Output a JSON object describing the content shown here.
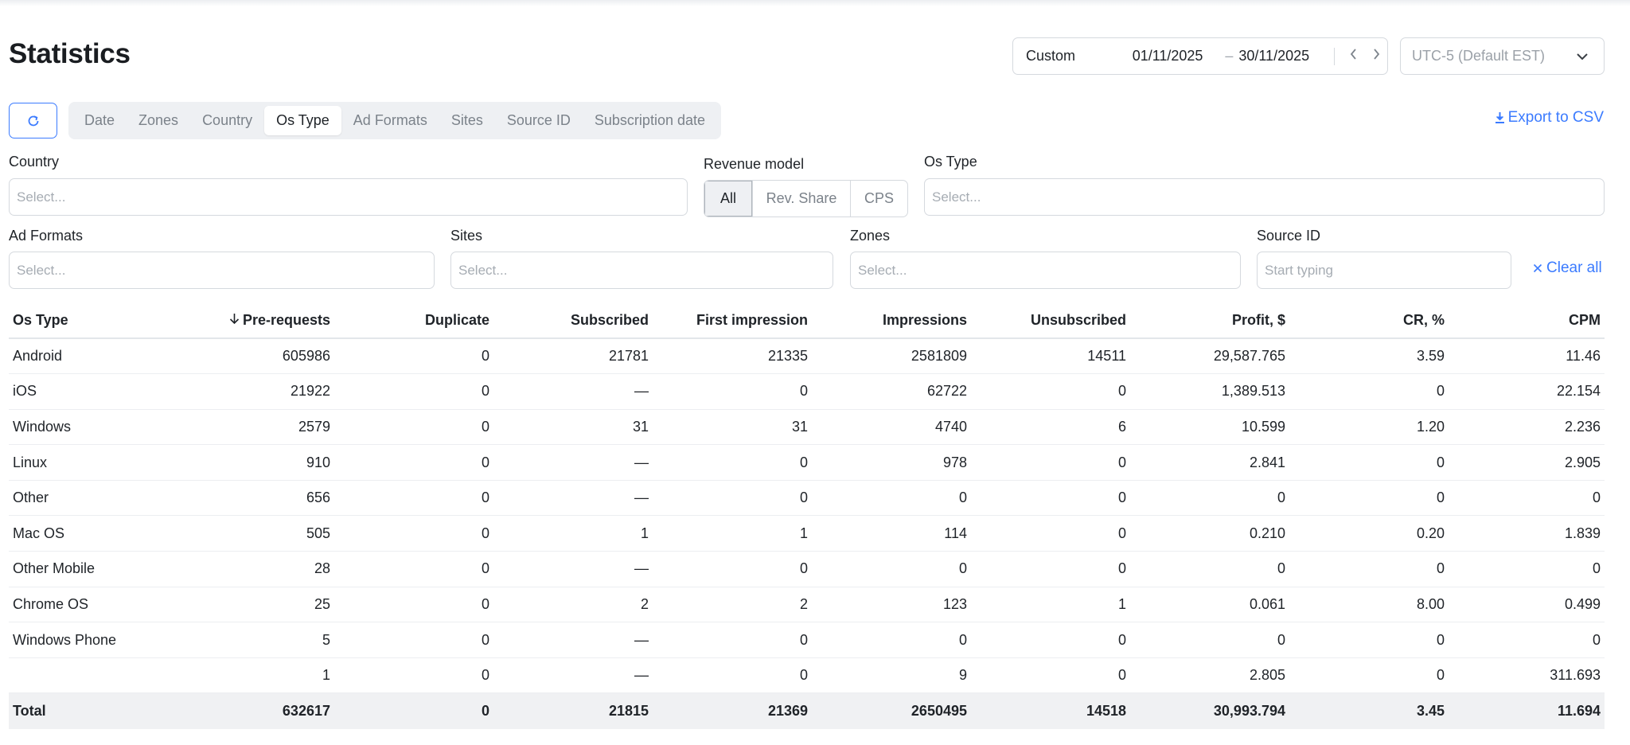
{
  "page": {
    "title": "Statistics"
  },
  "date_range": {
    "preset": "Custom",
    "from": "01/11/2025",
    "separator": "–",
    "to": "30/11/2025",
    "prev_icon": "chevron-left-icon",
    "next_icon": "chevron-right-icon"
  },
  "timezone": {
    "value": "UTC-5 (Default EST)"
  },
  "tabs": [
    {
      "label": "Date",
      "active": false
    },
    {
      "label": "Zones",
      "active": false
    },
    {
      "label": "Country",
      "active": false
    },
    {
      "label": "Os Type",
      "active": true
    },
    {
      "label": "Ad Formats",
      "active": false
    },
    {
      "label": "Sites",
      "active": false
    },
    {
      "label": "Source ID",
      "active": false
    },
    {
      "label": "Subscription date",
      "active": false
    }
  ],
  "export": {
    "label": "Export to CSV",
    "icon": "download-icon"
  },
  "filters": {
    "country": {
      "label": "Country",
      "placeholder": "Select..."
    },
    "revenue_model": {
      "label": "Revenue model",
      "options": [
        "All",
        "Rev. Share",
        "CPS"
      ],
      "selected": "All"
    },
    "os_type": {
      "label": "Os Type",
      "placeholder": "Select..."
    },
    "ad_formats": {
      "label": "Ad Formats",
      "placeholder": "Select..."
    },
    "sites": {
      "label": "Sites",
      "placeholder": "Select..."
    },
    "zones": {
      "label": "Zones",
      "placeholder": "Select..."
    },
    "source_id": {
      "label": "Source ID",
      "placeholder": "Start typing"
    },
    "clear_all": "Clear all"
  },
  "table": {
    "columns": [
      "Os Type",
      "Pre-requests",
      "Duplicate",
      "Subscribed",
      "First impression",
      "Impressions",
      "Unsubscribed",
      "Profit, $",
      "CR, %",
      "CPM"
    ],
    "sorted_column": "Pre-requests",
    "rows": [
      [
        "Android",
        "605986",
        "0",
        "21781",
        "21335",
        "2581809",
        "14511",
        "29,587.765",
        "3.59",
        "11.46"
      ],
      [
        "iOS",
        "21922",
        "0",
        "—",
        "0",
        "62722",
        "0",
        "1,389.513",
        "0",
        "22.154"
      ],
      [
        "Windows",
        "2579",
        "0",
        "31",
        "31",
        "4740",
        "6",
        "10.599",
        "1.20",
        "2.236"
      ],
      [
        "Linux",
        "910",
        "0",
        "—",
        "0",
        "978",
        "0",
        "2.841",
        "0",
        "2.905"
      ],
      [
        "Other",
        "656",
        "0",
        "—",
        "0",
        "0",
        "0",
        "0",
        "0",
        "0"
      ],
      [
        "Mac OS",
        "505",
        "0",
        "1",
        "1",
        "114",
        "0",
        "0.210",
        "0.20",
        "1.839"
      ],
      [
        "Other Mobile",
        "28",
        "0",
        "—",
        "0",
        "0",
        "0",
        "0",
        "0",
        "0"
      ],
      [
        "Chrome OS",
        "25",
        "0",
        "2",
        "2",
        "123",
        "1",
        "0.061",
        "8.00",
        "0.499"
      ],
      [
        "Windows Phone",
        "5",
        "0",
        "—",
        "0",
        "0",
        "0",
        "0",
        "0",
        "0"
      ],
      [
        "",
        "1",
        "0",
        "—",
        "0",
        "9",
        "0",
        "2.805",
        "0",
        "311.693"
      ]
    ],
    "total": [
      "Total",
      "632617",
      "0",
      "21815",
      "21369",
      "2650495",
      "14518",
      "30,993.794",
      "3.45",
      "11.694"
    ]
  },
  "colors": {
    "accent": "#3b7bff",
    "border": "#d5d9de",
    "tab_bg": "#eef0f3",
    "total_bg": "#f0f1f3"
  }
}
